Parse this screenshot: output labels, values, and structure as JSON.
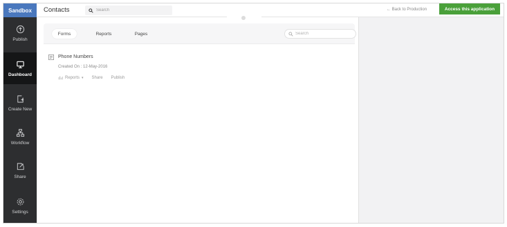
{
  "brand": "Sandbox",
  "header": {
    "title": "Contacts",
    "search_placeholder": "Search",
    "back_link": "← Back to Production",
    "access_button": "Access this application"
  },
  "sidebar": {
    "items": [
      {
        "label": "Publish",
        "icon": "upload-icon"
      },
      {
        "label": "Dashboard",
        "icon": "monitor-icon"
      },
      {
        "label": "Create New",
        "icon": "create-new-icon"
      },
      {
        "label": "Workflow",
        "icon": "workflow-icon"
      },
      {
        "label": "Share",
        "icon": "share-icon"
      },
      {
        "label": "Settings",
        "icon": "gear-icon"
      }
    ]
  },
  "panel": {
    "tabs": [
      {
        "label": "Forms",
        "active": true
      },
      {
        "label": "Reports",
        "active": false
      },
      {
        "label": "Pages",
        "active": false
      }
    ],
    "search_placeholder": "Search",
    "forms": [
      {
        "name": "Phone Numbers",
        "created": "Created On : 12-May-2016",
        "actions": {
          "reports": "Reports",
          "share": "Share",
          "publish": "Publish"
        }
      }
    ]
  },
  "colors": {
    "brand": "#4a78bd",
    "sidebar": "#2d2e30",
    "sidebar_active": "#151617",
    "access_button": "#4aa03a"
  }
}
